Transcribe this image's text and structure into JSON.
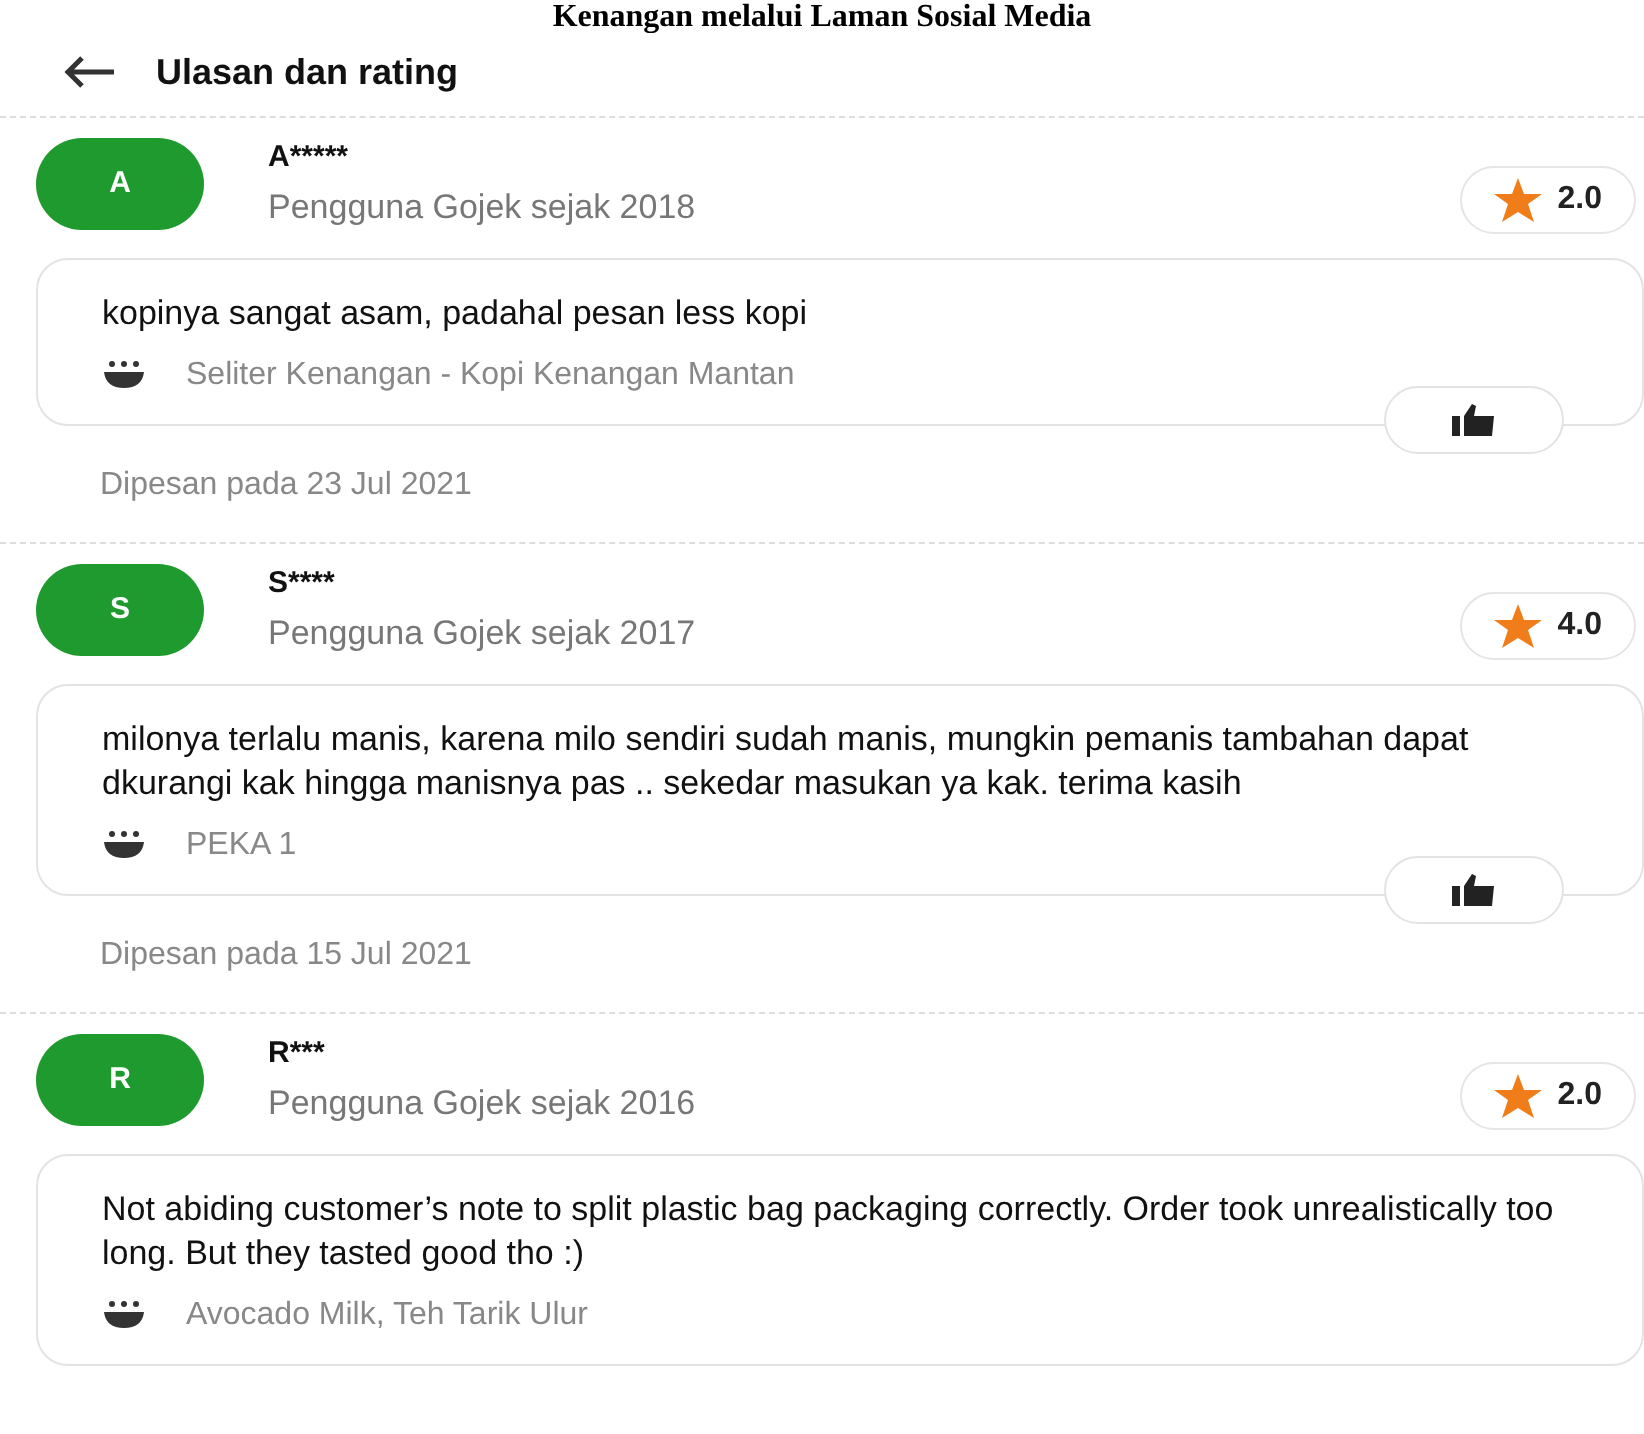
{
  "caption": "Kenangan melalui Laman Sosial Media",
  "header": {
    "title": "Ulasan dan rating"
  },
  "reviews": [
    {
      "initial": "A",
      "name": "A*****",
      "since": "Pengguna Gojek sejak 2018",
      "rating": "2.0",
      "text": "kopinya sangat asam, padahal pesan less kopi",
      "items": "Seliter Kenangan - Kopi Kenangan Mantan",
      "date": "Dipesan pada 23 Jul 2021"
    },
    {
      "initial": "S",
      "name": "S****",
      "since": "Pengguna Gojek sejak 2017",
      "rating": "4.0",
      "text": "milonya terlalu manis, karena milo sendiri sudah manis, mungkin pemanis tambahan dapat dkurangi kak hingga manisnya pas .. sekedar masukan ya kak. terima kasih",
      "items": "PEKA 1",
      "date": "Dipesan pada 15 Jul 2021"
    },
    {
      "initial": "R",
      "name": "R***",
      "since": "Pengguna Gojek sejak 2016",
      "rating": "2.0",
      "text": "Not abiding customer’s note to split plastic bag packaging correctly. Order took unrealistically too long. But they tasted good tho :)",
      "items": "Avocado Milk, Teh Tarik Ulur"
    }
  ]
}
